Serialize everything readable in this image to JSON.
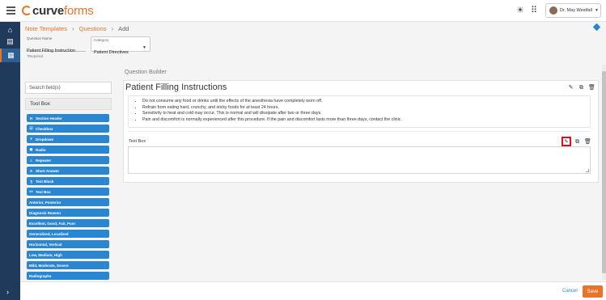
{
  "app": {
    "logo_part1": "curve",
    "logo_part2": "forms",
    "user_name": "Dr. May Westfall"
  },
  "breadcrumb": [
    {
      "label": "Note Templates"
    },
    {
      "label": "Questions"
    },
    {
      "label": "Add"
    }
  ],
  "form": {
    "question_name_label": "Question Name",
    "question_name_value": "Patient Filling Instruction",
    "category_label": "Category",
    "category_value": "Patient Directives",
    "required_note": "*Required"
  },
  "toolbox": {
    "search_placeholder": "Search field(s)",
    "title": "Tool Box",
    "items": [
      {
        "label": "Section Header",
        "icon": "section-header-icon",
        "glyph": "H"
      },
      {
        "label": "Checkbox",
        "icon": "checkbox-icon",
        "glyph": "☑"
      },
      {
        "label": "Dropdown",
        "icon": "dropdown-icon",
        "glyph": "▾"
      },
      {
        "label": "Radio",
        "icon": "radio-icon",
        "glyph": "◉"
      },
      {
        "label": "Repeater",
        "icon": "repeater-icon",
        "glyph": "≡"
      },
      {
        "label": "Short Answer",
        "icon": "short-answer-icon",
        "glyph": "A"
      },
      {
        "label": "Text Block",
        "icon": "text-block-icon",
        "glyph": "¶"
      },
      {
        "label": "Text Box",
        "icon": "text-box-icon",
        "glyph": "▭"
      },
      {
        "label": "Anterior, Posterior",
        "icon": "",
        "glyph": ""
      },
      {
        "label": "Diagnosis Reason",
        "icon": "",
        "glyph": ""
      },
      {
        "label": "Excellent, Good, Fair, Poor",
        "icon": "",
        "glyph": ""
      },
      {
        "label": "Generalized, Localized",
        "icon": "",
        "glyph": ""
      },
      {
        "label": "Horizontal, Vertical",
        "icon": "",
        "glyph": ""
      },
      {
        "label": "Low, Medium, High",
        "icon": "",
        "glyph": ""
      },
      {
        "label": "Mild, Moderate, Severe",
        "icon": "",
        "glyph": ""
      },
      {
        "label": "Radiographs",
        "icon": "",
        "glyph": ""
      }
    ]
  },
  "builder": {
    "section_label": "Question Builder",
    "card_title": "Patient Filling Instructions",
    "instructions": [
      "Do not consume any food or drinks until the effects of the anesthesia have completely worn off.",
      "Refrain from eating hard, crunchy, and sticky foods for at least 24 hours.",
      "Sensitivity to heat and cold may occur. This is normal and will dissipate after two or three days.",
      "Pain and discomfort is normally experienced after this procedure. If the pain and discomfort lasts more than three days, contact the clinic."
    ],
    "textbox_label": "Text Box"
  },
  "footer": {
    "cancel_label": "Cancel",
    "save_label": "Save"
  },
  "colors": {
    "accent": "#e8742a",
    "primary": "#2b86d1",
    "rail": "#1f3a5b",
    "highlight": "#e3101c"
  }
}
